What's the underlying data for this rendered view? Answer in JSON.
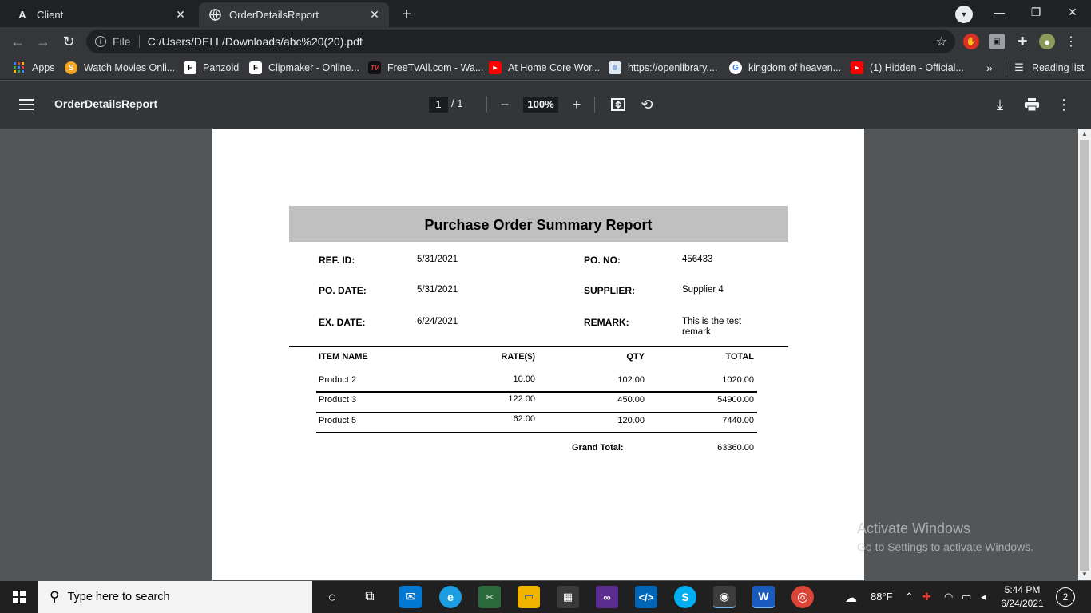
{
  "tabs": [
    {
      "title": "Client",
      "favicon": "A"
    },
    {
      "title": "OrderDetailsReport",
      "favicon": "globe"
    }
  ],
  "toolbar": {
    "scheme": "File",
    "url": "C:/Users/DELL/Downloads/abc%20(20).pdf"
  },
  "bookmarks": [
    {
      "label": "Apps",
      "icon": "apps-grid-icon"
    },
    {
      "label": "Watch Movies Onli...",
      "icon": "S"
    },
    {
      "label": "Panzoid",
      "icon": "F"
    },
    {
      "label": "Clipmaker - Online...",
      "icon": "F"
    },
    {
      "label": "FreeTvAll.com - Wa...",
      "icon": "TV"
    },
    {
      "label": "At Home Core Wor...",
      "icon": "youtube-icon"
    },
    {
      "label": "https://openlibrary....",
      "icon": "openlibrary-icon"
    },
    {
      "label": "kingdom of heaven...",
      "icon": "G"
    },
    {
      "label": "(1) Hidden - Official...",
      "icon": "youtube-icon"
    }
  ],
  "bookmarks_overflow": "»",
  "reading_list": "Reading list",
  "pdf": {
    "title": "OrderDetailsReport",
    "page_current": "1",
    "page_total": "/ 1",
    "zoom": "100%"
  },
  "report": {
    "heading": "Purchase Order Summary Report",
    "fields": {
      "ref_id_label": "REF. ID:",
      "ref_id_value": "5/31/2021",
      "po_no_label": "PO. NO:",
      "po_no_value": "456433",
      "po_date_label": "PO. DATE:",
      "po_date_value": "5/31/2021",
      "supplier_label": "SUPPLIER:",
      "supplier_value": "Supplier 4",
      "ex_date_label": "EX. DATE:",
      "ex_date_value": "6/24/2021",
      "remark_label": "REMARK:",
      "remark_value_line1": "This is the test",
      "remark_value_line2": "remark"
    },
    "columns": [
      "ITEM NAME",
      "RATE($)",
      "QTY",
      "TOTAL"
    ],
    "rows": [
      {
        "item": "Product 2",
        "rate": "10.00",
        "qty": "102.00",
        "total": "1020.00"
      },
      {
        "item": "Product 3",
        "rate": "122.00",
        "qty": "450.00",
        "total": "54900.00"
      },
      {
        "item": "Product 5",
        "rate": "62.00",
        "qty": "120.00",
        "total": "7440.00"
      }
    ],
    "grand_total_label": "Grand Total:",
    "grand_total_value": "63360.00"
  },
  "watermark": {
    "line1": "Activate Windows",
    "line2": "Go to Settings to activate Windows."
  },
  "taskbar": {
    "search_placeholder": "Type here to search",
    "weather": "88°F",
    "time": "5:44 PM",
    "date": "6/24/2021",
    "notifications": "2"
  }
}
